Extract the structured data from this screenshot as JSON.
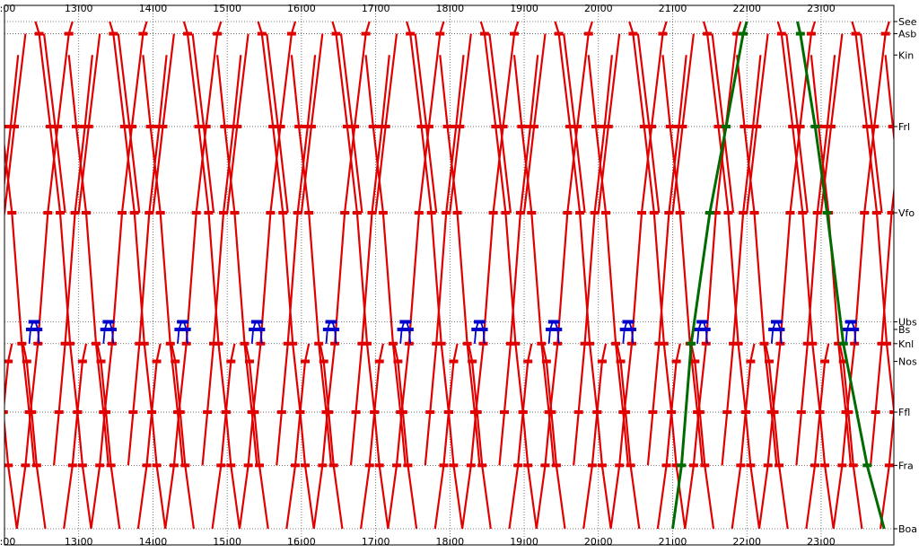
{
  "chart_data": {
    "type": "line",
    "title": "",
    "x_axis": {
      "tick_labels": [
        "2:00",
        "13:00",
        "14:00",
        "15:00",
        "16:00",
        "17:00",
        "18:00",
        "19:00",
        "20:00",
        "21:00",
        "22:00",
        "23:00"
      ],
      "tick_hours": [
        12,
        13,
        14,
        15,
        16,
        17,
        18,
        19,
        20,
        21,
        22,
        23
      ],
      "xlim": [
        12,
        23.98
      ],
      "unit": "hour of day"
    },
    "y_axis": {
      "stations": [
        "See",
        "Asb",
        "Kin",
        "Frl",
        "Vfo",
        "Ubs",
        "Bs",
        "Knl",
        "Nos",
        "Ffl",
        "Fra",
        "Boa"
      ],
      "station_pos": [
        0,
        0.024,
        0.066,
        0.207,
        0.377,
        0.592,
        0.607,
        0.635,
        0.67,
        0.77,
        0.875,
        1.0
      ],
      "gridline_stations": [
        "See",
        "Asb",
        "Frl",
        "Vfo",
        "Ubs",
        "Knl",
        "Ffl",
        "Fra",
        "Boa"
      ]
    },
    "grid": true,
    "colors": {
      "red": "#e00000",
      "green": "#006b00",
      "blue": "#0000cc",
      "orange": "#e59400"
    },
    "series": [
      {
        "color": "red",
        "period_min": 60,
        "offset_min": 10,
        "route": [
          [
            "Boa",
            0
          ],
          [
            "Fra",
            7
          ],
          [
            "Ffl",
            11
          ],
          [
            "Knl",
            17
          ],
          [
            "Vfo",
            25
          ],
          [
            "Frl",
            33
          ],
          [
            "Asb",
            42
          ],
          [
            "See",
            45
          ]
        ]
      },
      {
        "color": "red",
        "period_min": 60,
        "offset_min": 25,
        "route": [
          [
            "See",
            0
          ],
          [
            "Asb",
            3
          ],
          [
            "Frl",
            12
          ],
          [
            "Vfo",
            20
          ],
          [
            "Knl",
            28
          ],
          [
            "Ffl",
            34
          ],
          [
            "Fra",
            38
          ],
          [
            "Boa",
            45
          ]
        ]
      },
      {
        "color": "red",
        "period_min": 60,
        "offset_min": 40,
        "route": [
          [
            "Fra",
            0
          ],
          [
            "Ffl",
            4
          ],
          [
            "Knl",
            9
          ],
          [
            "Vfo",
            17
          ],
          [
            "Frl",
            25
          ],
          [
            "Kin",
            31
          ]
        ]
      },
      {
        "color": "red",
        "period_min": 60,
        "offset_min": 52,
        "route": [
          [
            "Kin",
            0
          ],
          [
            "Frl",
            6
          ],
          [
            "Vfo",
            14
          ],
          [
            "Knl",
            22
          ],
          [
            "Ffl",
            28
          ],
          [
            "Fra",
            32
          ]
        ]
      },
      {
        "color": "red",
        "period_min": 60,
        "offset_min": 0,
        "route": [
          [
            "Vfo",
            0
          ],
          [
            "Frl",
            8
          ],
          [
            "Asb",
            17
          ]
        ]
      },
      {
        "color": "red",
        "period_min": 60,
        "offset_min": 32,
        "route": [
          [
            "Asb",
            0
          ],
          [
            "Frl",
            9
          ],
          [
            "Vfo",
            17
          ]
        ]
      },
      {
        "color": "red",
        "period_min": 60,
        "offset_min": 15,
        "route": [
          [
            "Knl",
            0
          ],
          [
            "Nos",
            3
          ],
          [
            "Ffl",
            7
          ],
          [
            "Fra",
            11
          ],
          [
            "Boa",
            18
          ]
        ]
      },
      {
        "color": "red",
        "period_min": 60,
        "offset_min": 48,
        "route": [
          [
            "Boa",
            0
          ],
          [
            "Fra",
            7
          ],
          [
            "Ffl",
            11
          ],
          [
            "Nos",
            15
          ],
          [
            "Knl",
            18
          ]
        ]
      },
      {
        "color": "blue",
        "period_min": 60,
        "offset_min": 20,
        "route": [
          [
            "Knl",
            0
          ],
          [
            "Bs",
            1
          ],
          [
            "Ubs",
            3
          ],
          [
            "Ubs",
            5
          ],
          [
            "Bs",
            7
          ],
          [
            "Knl",
            8
          ]
        ]
      },
      {
        "color": "green",
        "period_min": 0,
        "offset_min": 0,
        "route": [
          [
            "Boa",
            21.0
          ],
          [
            "Fra",
            21.12
          ],
          [
            "Knl",
            21.25
          ],
          [
            "Vfo",
            21.5
          ],
          [
            "Frl",
            21.72
          ],
          [
            "Asb",
            21.95
          ],
          [
            "See",
            22.0
          ]
        ]
      },
      {
        "color": "green",
        "period_min": 0,
        "offset_min": 0,
        "route": [
          [
            "See",
            22.68
          ],
          [
            "Asb",
            22.72
          ],
          [
            "Frl",
            22.92
          ],
          [
            "Vfo",
            23.08
          ],
          [
            "Knl",
            23.3
          ],
          [
            "Fra",
            23.62
          ],
          [
            "Boa",
            23.85
          ]
        ]
      }
    ]
  }
}
